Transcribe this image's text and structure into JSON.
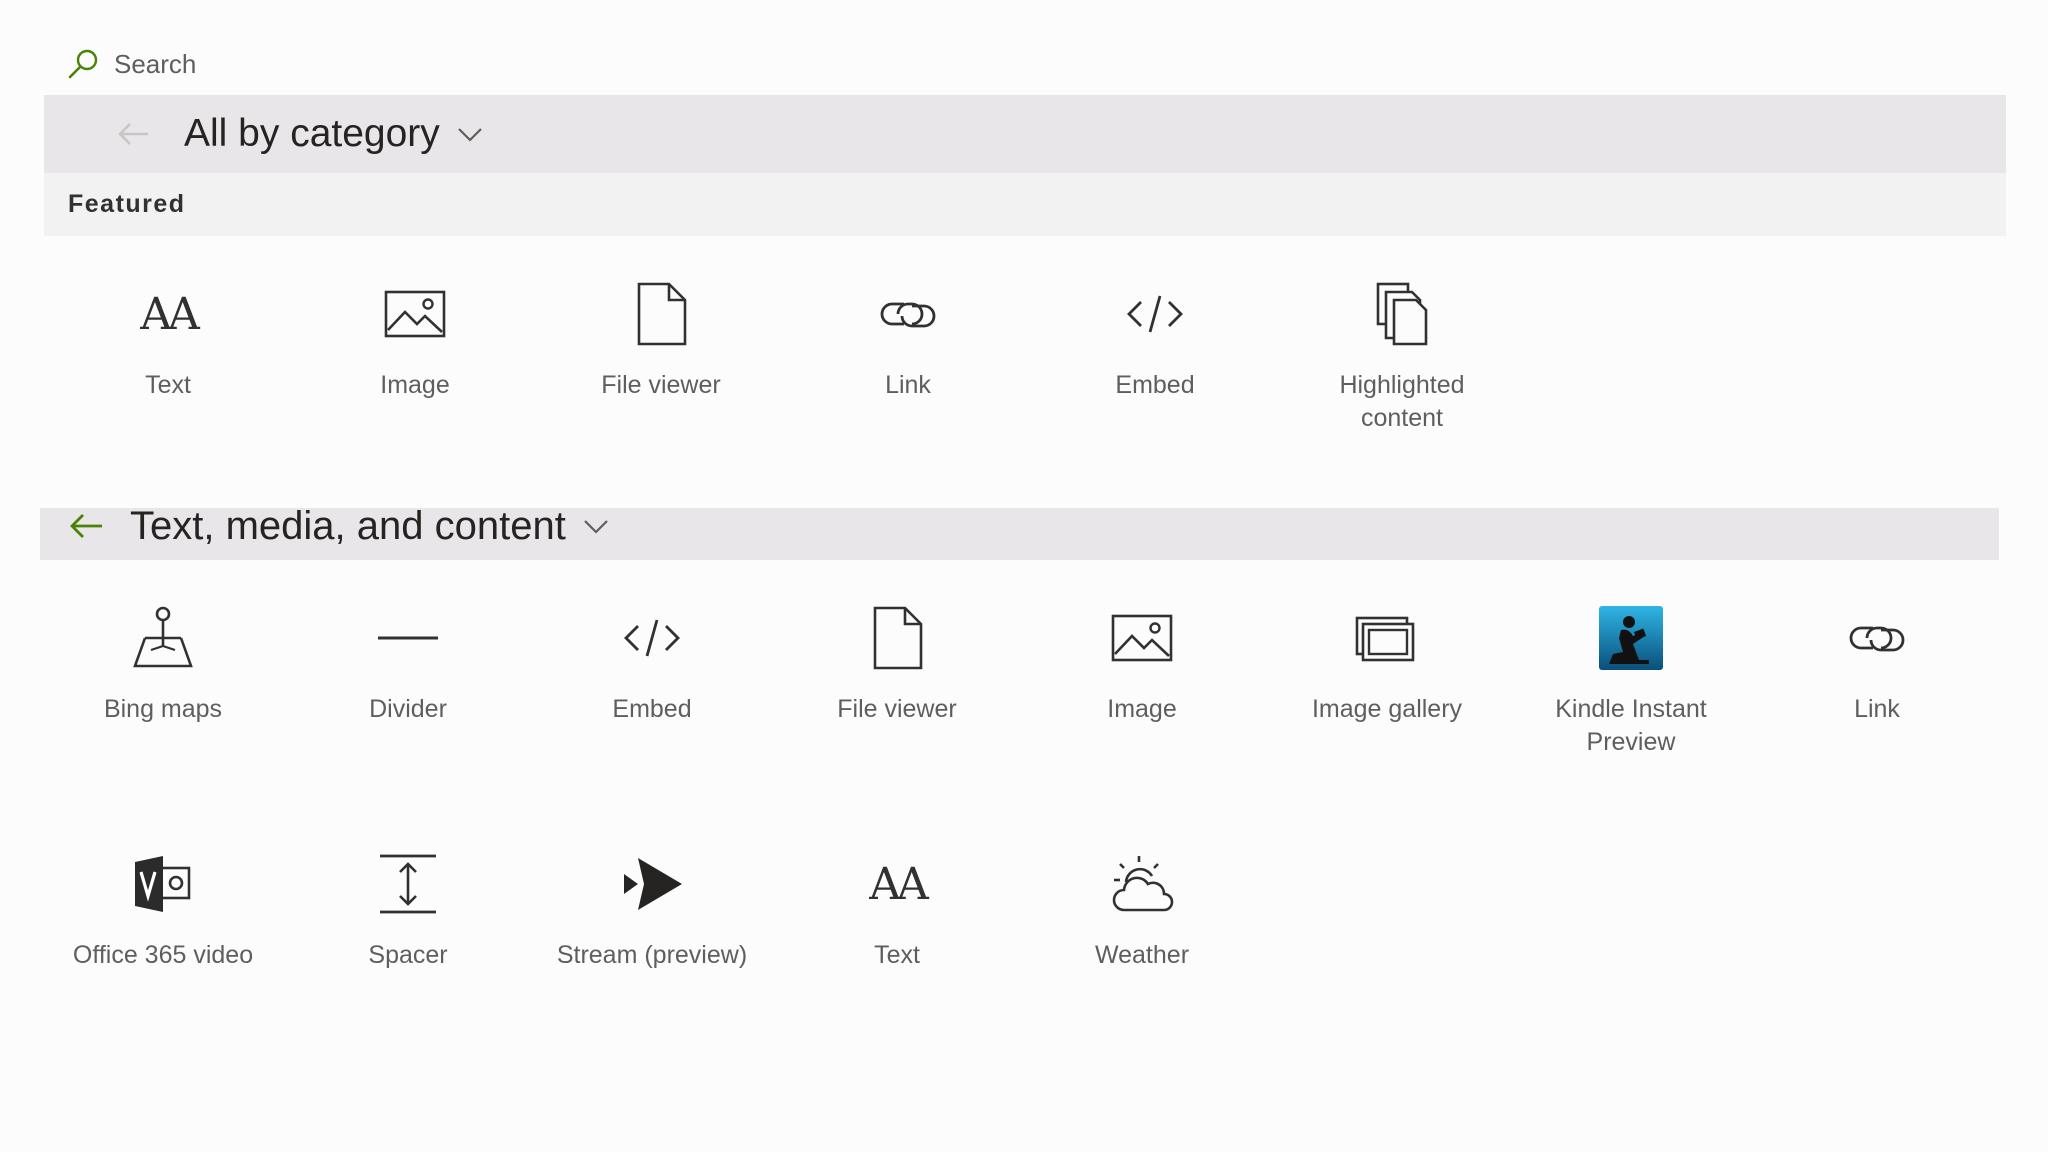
{
  "search": {
    "label": "Search"
  },
  "category_selector": {
    "title": "All by category"
  },
  "featured": {
    "heading": "Featured",
    "items": [
      {
        "label": "Text",
        "icon": "text-icon"
      },
      {
        "label": "Image",
        "icon": "image-icon"
      },
      {
        "label": "File viewer",
        "icon": "file-icon"
      },
      {
        "label": "Link",
        "icon": "link-icon"
      },
      {
        "label": "Embed",
        "icon": "embed-icon"
      },
      {
        "label": "Highlighted\ncontent",
        "icon": "highlighted-content-icon"
      }
    ]
  },
  "section": {
    "title": "Text, media, and content",
    "items": [
      {
        "label": "Bing maps",
        "icon": "bing-maps-icon"
      },
      {
        "label": "Divider",
        "icon": "divider-icon"
      },
      {
        "label": "Embed",
        "icon": "embed-icon"
      },
      {
        "label": "File viewer",
        "icon": "file-icon"
      },
      {
        "label": "Image",
        "icon": "image-icon"
      },
      {
        "label": "Image gallery",
        "icon": "image-gallery-icon"
      },
      {
        "label": "Kindle Instant Preview",
        "icon": "kindle-icon"
      },
      {
        "label": "Link",
        "icon": "link-icon"
      },
      {
        "label": "Office 365 video",
        "icon": "office-365-video-icon"
      },
      {
        "label": "Spacer",
        "icon": "spacer-icon"
      },
      {
        "label": "Stream (preview)",
        "icon": "stream-icon"
      },
      {
        "label": "Text",
        "icon": "text-icon"
      },
      {
        "label": "Weather",
        "icon": "weather-icon"
      }
    ]
  },
  "colors": {
    "accent": "#498205",
    "bar": "#e8e6e8",
    "subbar": "#f3f2f3",
    "text": "#323130",
    "label": "#605e5c"
  }
}
